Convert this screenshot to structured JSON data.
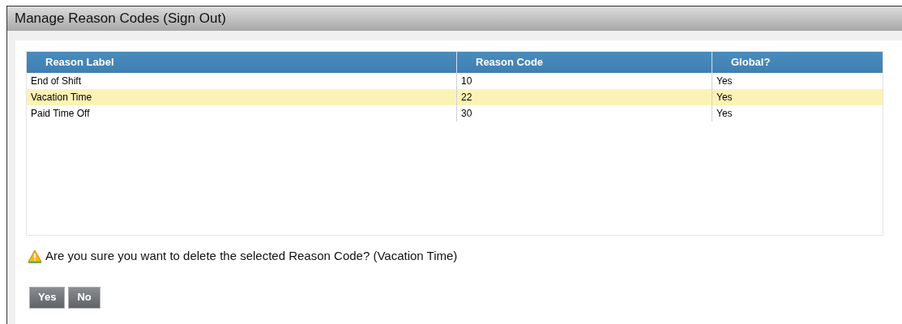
{
  "window": {
    "title": "Manage Reason Codes (Sign Out)"
  },
  "table": {
    "columns": [
      "Reason Label",
      "Reason Code",
      "Global?"
    ],
    "rows": [
      {
        "cells": [
          "End of Shift",
          "10",
          "Yes"
        ],
        "selected": false
      },
      {
        "cells": [
          "Vacation Time",
          "22",
          "Yes"
        ],
        "selected": true
      },
      {
        "cells": [
          "Paid Time Off",
          "30",
          "Yes"
        ],
        "selected": false
      }
    ]
  },
  "message": {
    "kind": "warning",
    "text": "Are you sure you want to delete the selected Reason Code? (Vacation Time)"
  },
  "buttons": [
    "Yes",
    "No"
  ]
}
